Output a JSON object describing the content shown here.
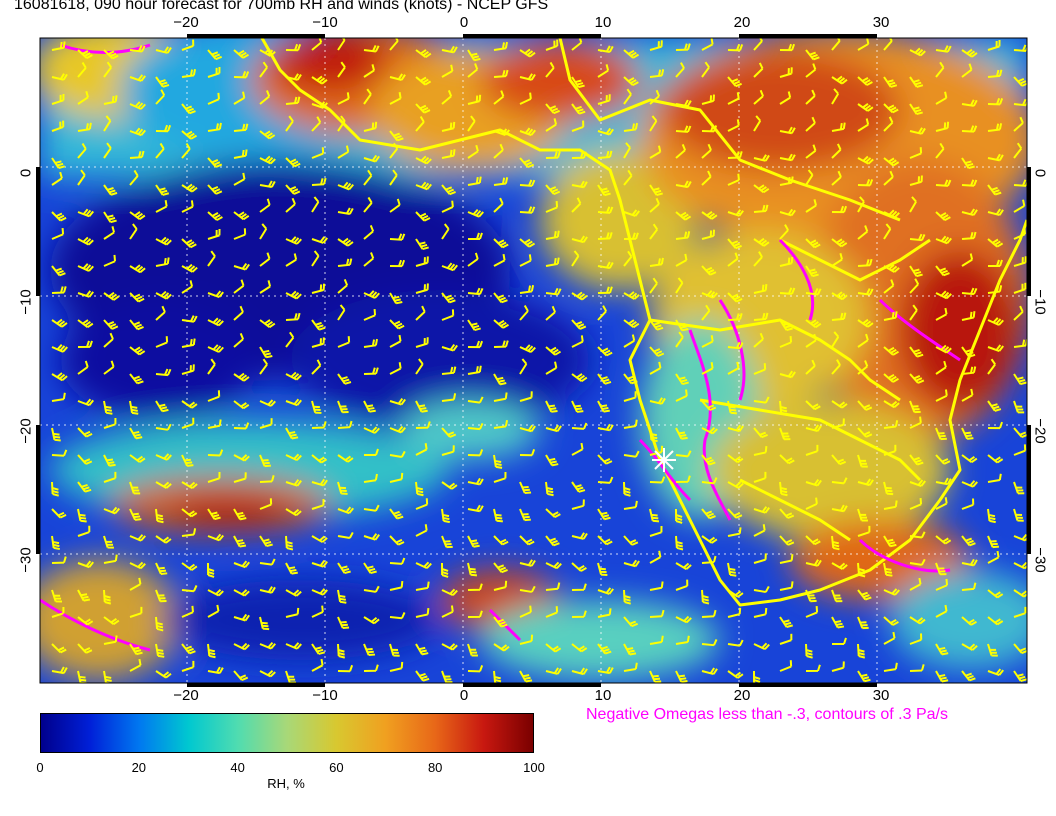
{
  "title": "16081618, 090 hour forecast for 700mb RH and winds (knots) - NCEP GFS",
  "map": {
    "lon_ticks": [
      "−20",
      "−10",
      "0",
      "10",
      "20",
      "30"
    ],
    "lon_values": [
      -20,
      -10,
      0,
      10,
      20,
      30
    ],
    "lat_ticks": [
      "0",
      "−10",
      "−20",
      "−30"
    ],
    "lat_values": [
      0,
      -10,
      -20,
      -30
    ],
    "extent": {
      "lon": [
        -30.5,
        40.5
      ],
      "lat": [
        -39.5,
        10.5
      ]
    },
    "colors": {
      "border_lines": "#ffff00",
      "wind_barbs": "#ffff00",
      "omega_contours": "#ff00ff",
      "grid": "#ffffff"
    }
  },
  "legend": {
    "omega_note": "Negative Omegas less than -.3, contours of .3 Pa/s",
    "colorbar": {
      "labels": [
        "0",
        "20",
        "40",
        "60",
        "80",
        "100"
      ],
      "values": [
        0,
        20,
        40,
        60,
        80,
        100
      ],
      "title": "RH, %",
      "colors": [
        "#00008c",
        "#0020d8",
        "#0078f0",
        "#00c8d0",
        "#50dcb0",
        "#a8d878",
        "#d8c830",
        "#f0a020",
        "#e86818",
        "#c81810",
        "#7a0000"
      ]
    }
  }
}
